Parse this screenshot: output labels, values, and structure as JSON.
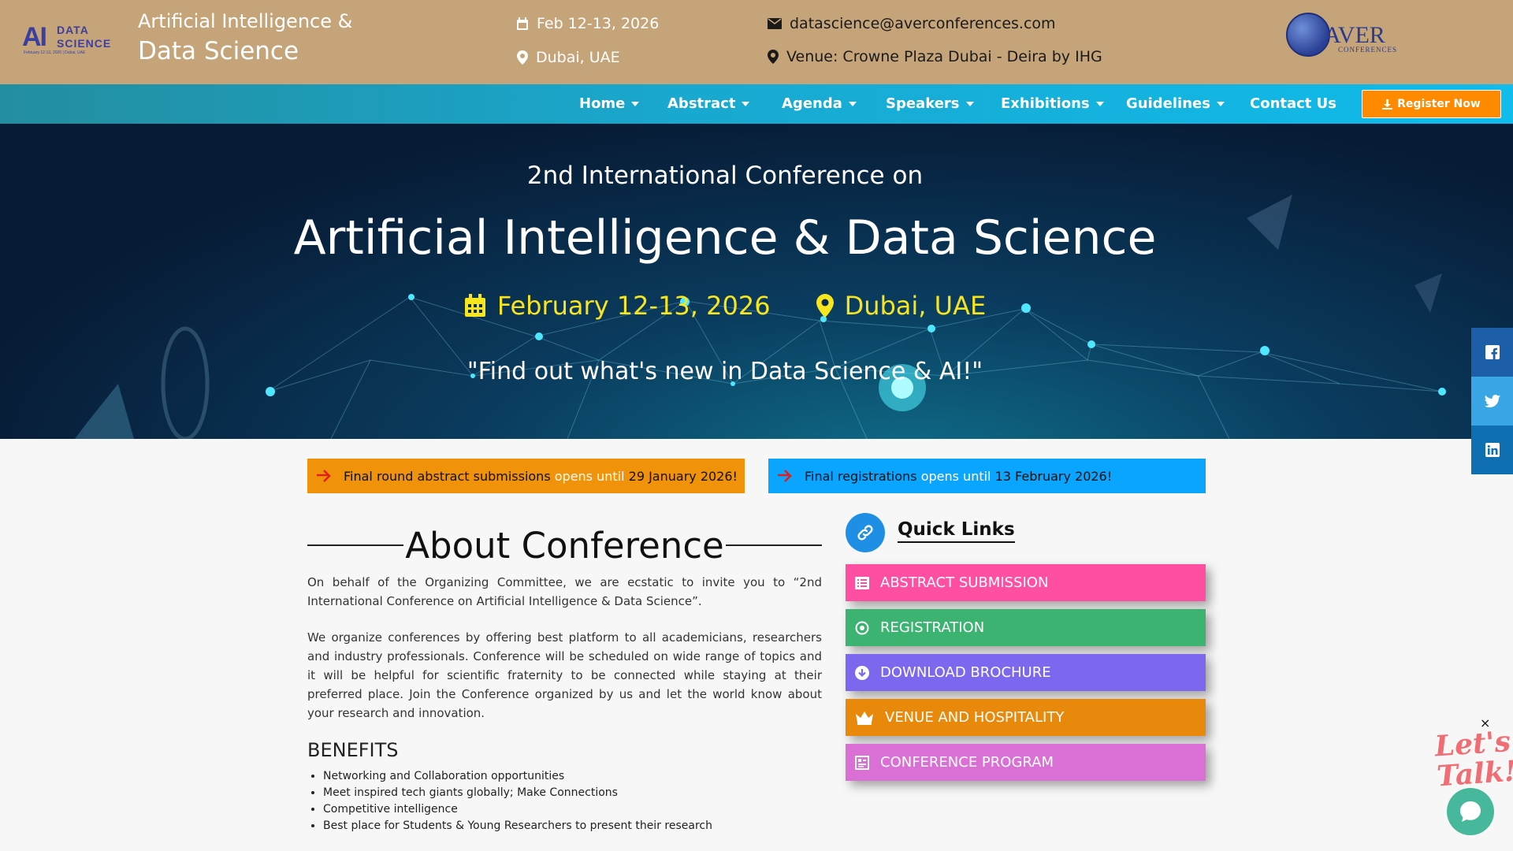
{
  "header": {
    "logo": {
      "big": "AI",
      "line1": "DATA",
      "line2": "SCIENCE",
      "tiny": "February 12-13, 2026 | Dubai, UAE"
    },
    "title_line1": "Artificial Intelligence &",
    "title_line2": "Data Science",
    "date": "Feb 12-13, 2026",
    "location": "Dubai, UAE",
    "email": "datascience@averconferences.com",
    "venue": "Venue: Crowne Plaza Dubai - Deira by IHG",
    "brand": {
      "name": "AVER",
      "sub": "CONFERENCES"
    }
  },
  "nav": {
    "items": [
      {
        "label": "Home",
        "caret": true
      },
      {
        "label": "Abstract",
        "caret": true
      },
      {
        "label": "Agenda",
        "caret": true
      },
      {
        "label": "Speakers",
        "caret": true
      },
      {
        "label": "Exhibitions",
        "caret": true
      },
      {
        "label": "Guidelines",
        "caret": true
      },
      {
        "label": "Contact Us",
        "caret": false
      }
    ],
    "register_label": "Register Now"
  },
  "hero": {
    "subtitle": "2nd International Conference on",
    "title": "Artificial Intelligence & Data Science",
    "date": "February 12-13, 2026",
    "location": "Dubai, UAE",
    "tagline": "\"Find out what's new in Data Science & AI!\""
  },
  "notices": {
    "abstract": {
      "pre": "Final round abstract submissions ",
      "highlight": "opens until",
      "post": " 29 January 2026!"
    },
    "registration": {
      "pre": "Final registrations ",
      "highlight": "opens until",
      "post": " 13 February 2026!"
    }
  },
  "about": {
    "heading": "About Conference",
    "para1": "On behalf of the Organizing Committee, we are ecstatic to invite you to “2nd International Conference on Artificial Intelligence & Data Science”.",
    "para2": "We organize conferences by offering best platform to all academicians, researchers and industry professionals. Conference will be scheduled on wide range of topics and it will be helpful for scientific fraternity to be connected while staying at their preferred place. Join the Conference organized by us and let the world know about your research and innovation.",
    "benefits_title": "BENEFITS",
    "benefits": [
      "Networking and Collaboration opportunities",
      "Meet inspired tech giants globally; Make Connections",
      "Competitive intelligence",
      "Best place for Students & Young Researchers to present their research"
    ]
  },
  "quick_links": {
    "title": "Quick Links",
    "items": [
      {
        "label": "ABSTRACT SUBMISSION",
        "icon": "list-icon",
        "color": "#ff4fa3"
      },
      {
        "label": "REGISTRATION",
        "icon": "target-icon",
        "color": "#3cb371"
      },
      {
        "label": "DOWNLOAD BROCHURE",
        "icon": "download-circle-icon",
        "color": "#7b68ee"
      },
      {
        "label": "VENUE AND HOSPITALITY",
        "icon": "crown-icon",
        "color": "#e8890c"
      },
      {
        "label": "CONFERENCE PROGRAM",
        "icon": "program-icon",
        "color": "#da70d6"
      }
    ]
  },
  "social": [
    "facebook-icon",
    "twitter-icon",
    "linkedin-icon"
  ],
  "chat": {
    "text_line1": "Let's",
    "text_line2": "Talk!",
    "close": "×"
  },
  "colors": {
    "header_bg": "#c6a47a",
    "nav_start": "#238ea0",
    "nav_end": "#0fbcec",
    "register_bg": "#ff8a00",
    "hero_accent": "#f7e51d",
    "notice_orange": "#f0920a",
    "notice_blue": "#0aa5ff"
  }
}
